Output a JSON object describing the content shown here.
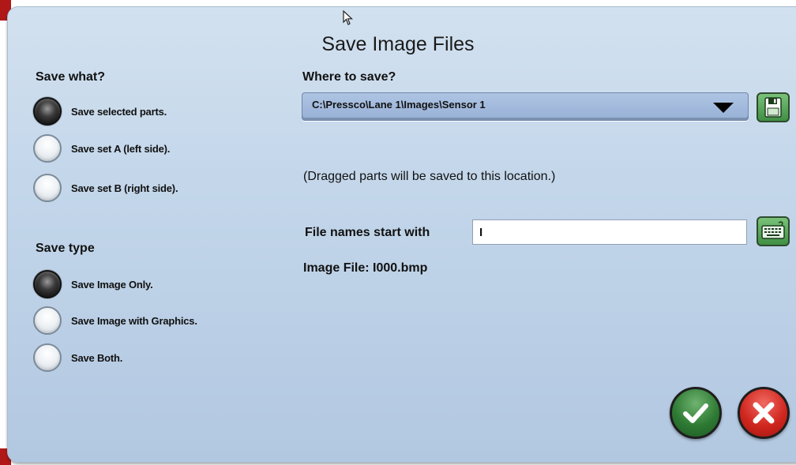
{
  "dialog": {
    "title": "Save Image Files"
  },
  "save_what": {
    "heading": "Save what?",
    "options": [
      {
        "label": "Save selected parts.",
        "checked": true
      },
      {
        "label": "Save set A (left side).",
        "checked": false
      },
      {
        "label": "Save set B (right side).",
        "checked": false
      }
    ]
  },
  "save_type": {
    "heading": "Save type",
    "options": [
      {
        "label": "Save Image Only.",
        "checked": true
      },
      {
        "label": "Save Image with Graphics.",
        "checked": false
      },
      {
        "label": "Save Both.",
        "checked": false
      }
    ]
  },
  "where": {
    "heading": "Where to save?",
    "path": "C:\\Pressco\\Lane 1\\Images\\Sensor 1",
    "note": "(Dragged parts will be saved to this location.)"
  },
  "filename": {
    "label": "File names start with",
    "value": "I",
    "image_file": "Image File: I000.bmp"
  },
  "icons": {
    "save": "floppy-disk-icon",
    "keyboard": "keyboard-icon",
    "ok": "checkmark-icon",
    "cancel": "x-icon",
    "cursor": "mouse-pointer-icon"
  },
  "colors": {
    "ok": "#2e7a34",
    "cancel": "#d0271f",
    "icon_button": "#3f8f43"
  }
}
